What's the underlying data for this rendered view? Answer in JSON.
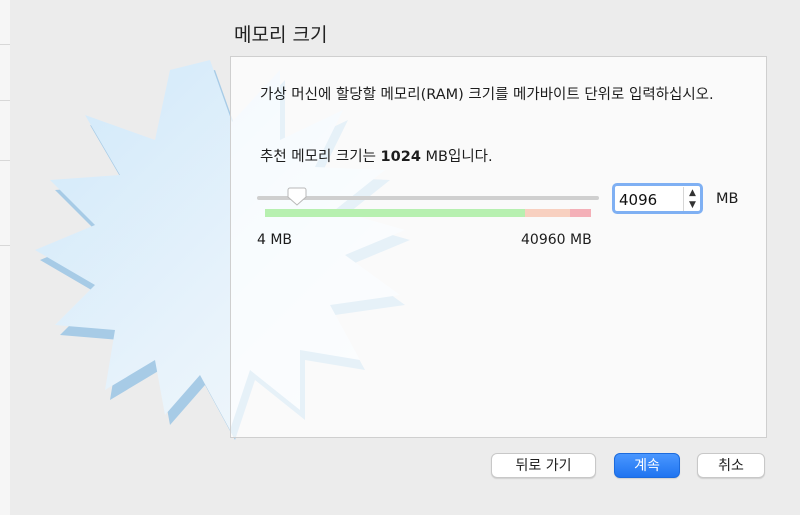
{
  "dialog": {
    "title": "메모리 크기",
    "description": "가상 머신에 할당할 메모리(RAM) 크기를 메가바이트 단위로 입력하십시오.",
    "recommended_prefix": "추천 메모리 크기는 ",
    "recommended_value": "1024",
    "recommended_suffix": " MB입니다."
  },
  "memory": {
    "min_label": "4 MB",
    "max_label": "40960 MB",
    "value": "4096",
    "unit": "MB",
    "slider_fraction": 0.1,
    "zone_colors": {
      "safe": "#b7f0b0",
      "warning": "#f8d0c0",
      "danger": "#f4b0b8"
    }
  },
  "buttons": {
    "back": "뒤로 가기",
    "continue": "계속",
    "cancel": "취소"
  }
}
